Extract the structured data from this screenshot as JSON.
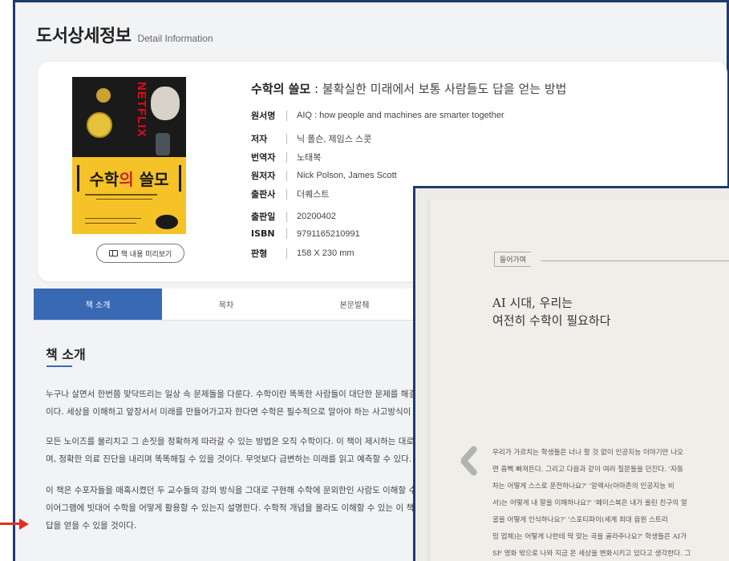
{
  "header": {
    "title": "도서상세정보",
    "subtitle": "Detail Information"
  },
  "book": {
    "title_main": "수학의 쓸모",
    "title_sep": " : ",
    "title_sub": "불확실한 미래에서 보통 사람들도 답을 얻는 방법",
    "cover_text_a": "수학",
    "cover_text_b": "의 ",
    "cover_text_c": "쓸모",
    "cover_brand": "NETFLIX",
    "preview_button": "책 내용 미리보기",
    "meta": [
      {
        "label": "원서명",
        "value": "AIQ : how people and machines are smarter together"
      },
      {
        "label": "저자",
        "value": "닉 폴슨, 제임스 스콧"
      },
      {
        "label": "번역자",
        "value": "노태복"
      },
      {
        "label": "원저자",
        "value": "Nick Polson, James Scott"
      },
      {
        "label": "출판사",
        "value": "더퀘스트"
      },
      {
        "label": "출판일",
        "value": "20200402"
      },
      {
        "label": "ISBN",
        "value": "9791165210991"
      },
      {
        "label": "판형",
        "value": "158 X 230 mm"
      }
    ]
  },
  "tabs": [
    {
      "label": "책 소개",
      "active": true
    },
    {
      "label": "목차",
      "active": false
    },
    {
      "label": "본문발췌",
      "active": false
    }
  ],
  "intro": {
    "heading": "책 소개",
    "paragraphs": [
      [
        "누구나 살면서 한번쯤 맞닥뜨리는 일상 속 문제들을 다룬다. 수학이란 똑똑한 사람들이 대단한 문제를 해결",
        "이다. 세상을 이해하고 앞장서서 미래를 만들어가고자 한다면 수학은 필수적으로 알아야 하는 사고방식이"
      ],
      [
        "모든 노이즈를 물리치고 그 손짓을 정확하게 따라갈 수 있는 방법은 오직 수학이다. 이 책이 제시하는 대로",
        "며, 정확한 의료 진단을 내리며 똑똑해질 수 있을 것이다. 무엇보다 급변하는 미래를 읽고 예측할 수 있다."
      ],
      [
        "이 책은 수포자들을 매혹시켰던 두 교수들의 강의 방식을 그대로 구현해 수학에 문외한인 사람도 이해할 수",
        "이어그램에 빗대어 수학을 어떻게 활용할 수 있는지 설명한다. 수학적 개념을 몰라도 이해할 수 있는 이 책",
        "답을 얻을 수 있을 것이다."
      ]
    ]
  },
  "preview_page": {
    "tag": "들어가며",
    "heading_lines": [
      "AI 시대, 우리는",
      "여전히 수학이 필요하다"
    ],
    "body_lines": [
      "우리가 가르치는 학생들은 너나 할 것 없이 인공지능 이야기만 나오",
      "면 흠뻑 빠져든다. 그리고 다음과 같이 여러 질문들을 던진다. '자동",
      "차는 어떻게 스스로 운전하나요?' '알렉사(아마존의 인공지능 비",
      "서)는 어떻게 내 말을 이해하나요?' '페이스북은 내가 올린 친구의 얼",
      "굴을 어떻게 인식하나요?' '스포티파이(세계 최대 음원 스트리",
      "밍 업체)는 어떻게 나한테 딱 맞는 곡을 골라주나요?' 학생들은 AI가",
      "SF 영화 밖으로 나와 지금 온 세상을 변화시키고 있다고 생각한다. 그"
    ]
  },
  "colors": {
    "accent_blue": "#3a69b4",
    "frame_navy": "#1f3a6e",
    "arrow_red": "#e0301e",
    "cover_yellow": "#f5c227"
  }
}
